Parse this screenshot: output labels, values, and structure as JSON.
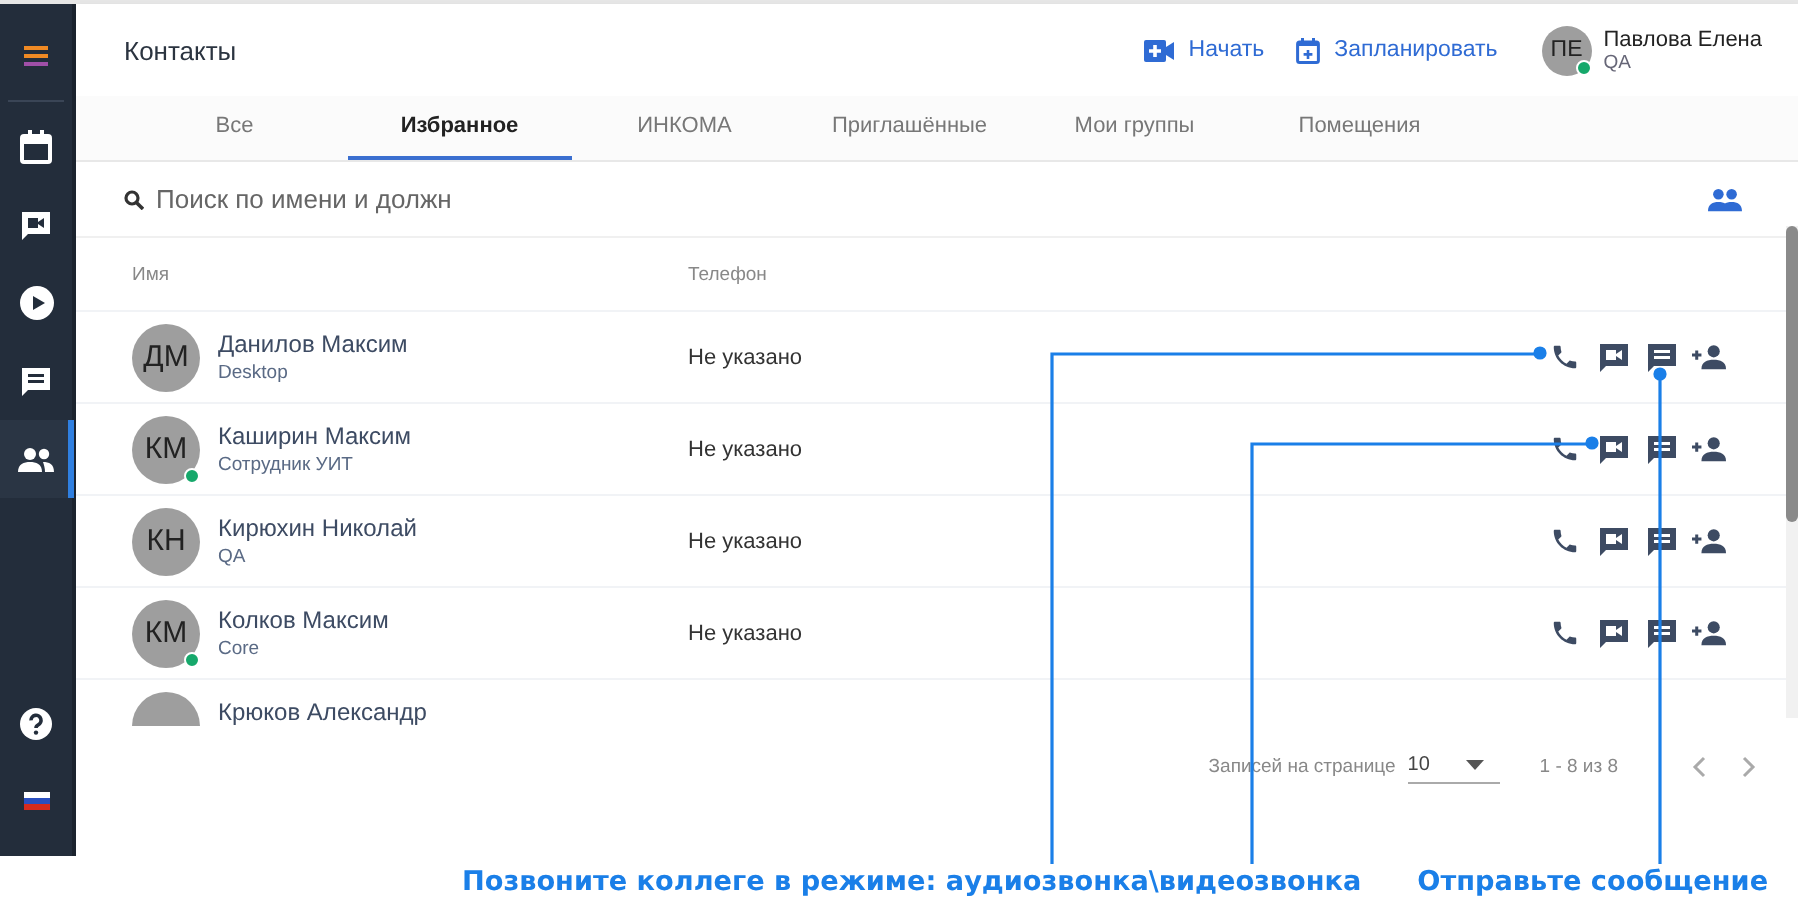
{
  "sidebar": {
    "items": [
      {
        "kind": "menu",
        "selected": false
      },
      {
        "kind": "calendar",
        "selected": false
      },
      {
        "kind": "video",
        "selected": false
      },
      {
        "kind": "play",
        "selected": false
      },
      {
        "kind": "chat",
        "selected": false
      },
      {
        "kind": "contacts",
        "selected": true
      },
      {
        "kind": "help",
        "selected": false
      },
      {
        "kind": "language",
        "selected": false
      }
    ]
  },
  "header": {
    "title": "Контакты",
    "actions": [
      {
        "kind": "start",
        "label": "Начать"
      },
      {
        "kind": "schedule",
        "label": "Запланировать"
      }
    ],
    "user": {
      "initials": "ПЕ",
      "name": "Павлова Елена",
      "role": "QA",
      "online": true
    }
  },
  "tabs": [
    {
      "label": "Все",
      "selected": false
    },
    {
      "label": "Избранное",
      "selected": true
    },
    {
      "label": "ИНКОМА",
      "selected": false
    },
    {
      "label": "Приглашённые",
      "selected": false
    },
    {
      "label": "Мои группы",
      "selected": false
    },
    {
      "label": "Помещения",
      "selected": false
    }
  ],
  "search": {
    "placeholder": "Поиск по имени и должн"
  },
  "table": {
    "columns": [
      "Имя",
      "Телефон"
    ],
    "rows": [
      {
        "initials": "ДМ",
        "name": "Данилов Максим",
        "subtitle": "Desktop",
        "online": false,
        "phone": "Не указано"
      },
      {
        "initials": "КМ",
        "name": "Каширин Максим",
        "subtitle": "Сотрудник УИТ",
        "online": true,
        "phone": "Не указано"
      },
      {
        "initials": "КН",
        "name": "Кирюхин Николай",
        "subtitle": "QA",
        "online": false,
        "phone": "Не указано"
      },
      {
        "initials": "КМ",
        "name": "Колков Максим",
        "subtitle": "Core",
        "online": true,
        "phone": "Не указано"
      },
      {
        "name": "Крюков Александр"
      }
    ]
  },
  "pagination": {
    "label": "Записей на странице",
    "page_size": "10",
    "range": "1 - 8 из 8"
  },
  "annotations": [
    {
      "text": "Позвоните коллеге в режиме: аудиозвонка\\видеозвонка"
    },
    {
      "text": "Отправьте сообщение"
    }
  ]
}
